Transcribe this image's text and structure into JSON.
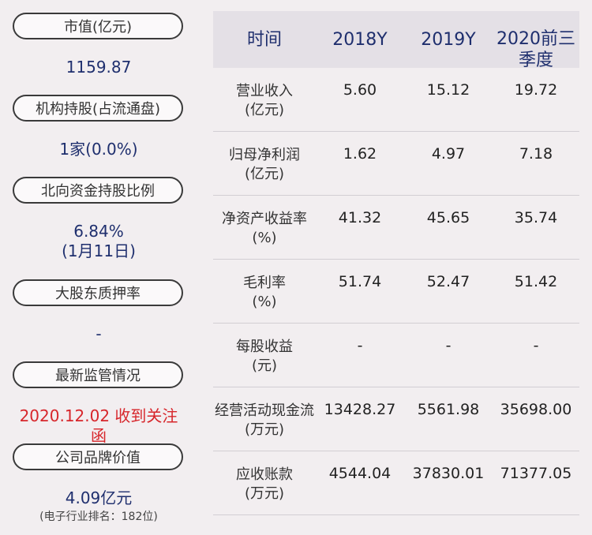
{
  "left_panel": {
    "items": [
      {
        "label": "市值(亿元)",
        "value": "1159.87"
      },
      {
        "label": "机构持股(占流通盘)",
        "value": "1家(0.0%)"
      },
      {
        "label": "北向资金持股比例",
        "value": "6.84%",
        "value2": "(1月11日)"
      },
      {
        "label": "大股东质押率",
        "value": "-"
      },
      {
        "label": "最新监管情况",
        "value": "2020.12.02 收到关注函"
      },
      {
        "label": "公司品牌价值",
        "value": "4.09亿元",
        "note": "(电子行业排名：182位)"
      }
    ],
    "highlight_color": "#d7262b",
    "value_color": "#1f2f6e"
  },
  "table": {
    "headers": [
      "时间",
      "2018Y",
      "2019Y",
      "2020前三季度"
    ],
    "rows": [
      {
        "label1": "营业收入",
        "label2": "(亿元)",
        "values": [
          "5.60",
          "15.12",
          "19.72"
        ]
      },
      {
        "label1": "归母净利润",
        "label2": "(亿元)",
        "values": [
          "1.62",
          "4.97",
          "7.18"
        ]
      },
      {
        "label1": "净资产收益率",
        "label2": "(%)",
        "values": [
          "41.32",
          "45.65",
          "35.74"
        ]
      },
      {
        "label1": "毛利率",
        "label2": "(%)",
        "values": [
          "51.74",
          "52.47",
          "51.42"
        ]
      },
      {
        "label1": "每股收益",
        "label2": "(元)",
        "values": [
          "-",
          "-",
          "-"
        ]
      },
      {
        "label1": "经营活动现金流",
        "label2": "(万元)",
        "values": [
          "13428.27",
          "5561.98",
          "35698.00"
        ]
      },
      {
        "label1": "应收账款",
        "label2": "(万元)",
        "values": [
          "4544.04",
          "37830.01",
          "71377.05"
        ]
      }
    ]
  }
}
